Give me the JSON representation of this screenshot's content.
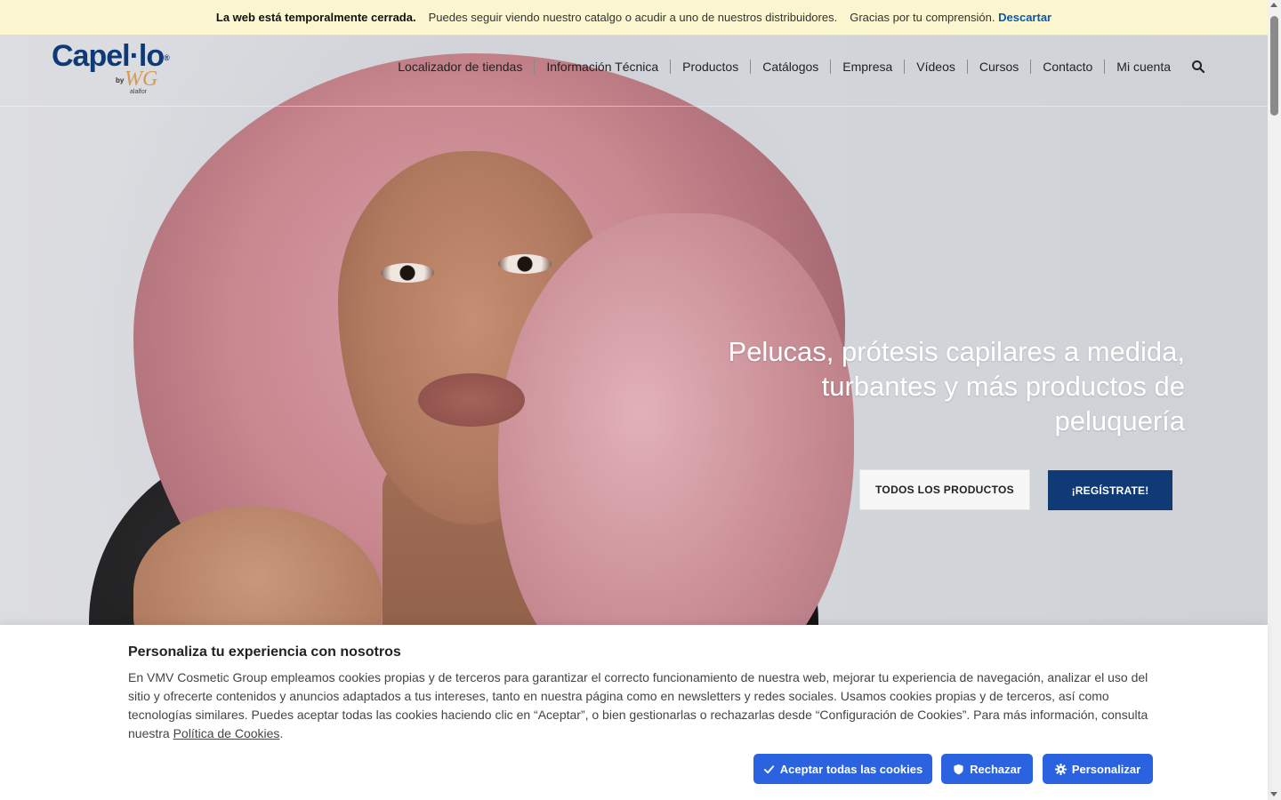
{
  "notice": {
    "strong": "La web está temporalmente cerrada.",
    "text": "Puedes seguir viendo nuestro catalgo o acudir a uno de nuestros distribuidores.",
    "thanks": "Gracias por tu comprensión.",
    "dismiss": "Descartar"
  },
  "logo": {
    "brand": "Capel·lo",
    "registered": "®",
    "by": "by",
    "wg": "WG",
    "sub": "alalfor"
  },
  "nav": {
    "items": [
      "Localizador de tiendas",
      "Información Técnica",
      "Productos",
      "Catálogos",
      "Empresa",
      "Vídeos",
      "Cursos",
      "Contacto",
      "Mi cuenta"
    ]
  },
  "hero": {
    "headline": "Pelucas, prótesis capilares a medida, turbantes y más productos de peluquería",
    "btn_products": "TODOS LOS PRODUCTOS",
    "btn_register": "¡REGÍSTRATE!"
  },
  "cookie": {
    "title": "Personaliza tu experiencia con nosotros",
    "body": "En VMV Cosmetic Group empleamos cookies propias y de terceros para garantizar el correcto funcionamiento de nuestra web, mejorar tu experiencia de navegación, analizar el uso del sitio y ofrecerte contenidos y anuncios adaptados a tus intereses, tanto en nuestra página como en newsletters y redes sociales. Usamos cookies propias y de terceros, así como tecnologías similares. Puedes aceptar todas las cookies haciendo clic en “Aceptar”, o bien gestionarlas o rechazarlas desde “Configuración de Cookies”. Para más información, consulta nuestra",
    "policy_link": "Política de Cookies",
    "period": ".",
    "accept": "Aceptar todas las cookies",
    "reject": "Rechazar",
    "customize": "Personalizar"
  },
  "colors": {
    "brand_blue": "#0f3a76",
    "cookie_button": "#2b62e0",
    "notice_bg": "#fbf6cf",
    "link": "#0a59a8"
  }
}
